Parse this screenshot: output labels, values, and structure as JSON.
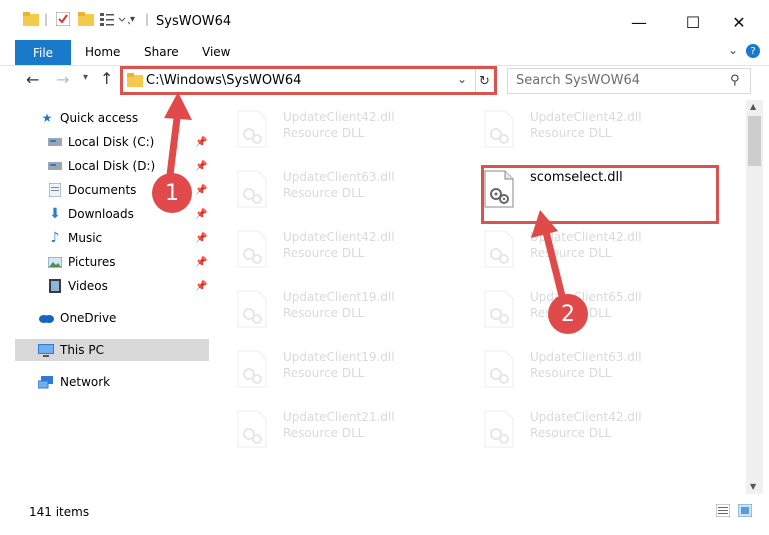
{
  "window": {
    "title": "SysWOW64",
    "minimize": "—",
    "maximize": "☐",
    "close": "✕"
  },
  "ribbon": {
    "tabs": [
      "File",
      "Home",
      "Share",
      "View"
    ],
    "expand": "⌄",
    "help": "?"
  },
  "address": {
    "path": "C:\\Windows\\SysWOW64",
    "dropdown": "⌄",
    "refresh": "↻"
  },
  "search": {
    "placeholder": "Search SysWOW64"
  },
  "nav": {
    "quick_access": "Quick access",
    "items": [
      {
        "label": "Local Disk (C:)",
        "icon": "drive-icon",
        "pinned": true
      },
      {
        "label": "Local Disk (D:)",
        "icon": "drive-icon",
        "pinned": true
      },
      {
        "label": "Documents",
        "icon": "documents-icon",
        "pinned": true
      },
      {
        "label": "Downloads",
        "icon": "downloads-icon",
        "pinned": true
      },
      {
        "label": "Music",
        "icon": "music-icon",
        "pinned": true
      },
      {
        "label": "Pictures",
        "icon": "pictures-icon",
        "pinned": true
      },
      {
        "label": "Videos",
        "icon": "videos-icon",
        "pinned": true
      }
    ],
    "onedrive": "OneDrive",
    "this_pc": "This PC",
    "network": "Network"
  },
  "files": {
    "left": [
      {
        "name": "UpdateClient42.dll",
        "type": "Resource DLL"
      },
      {
        "name": "UpdateClient63.dll",
        "type": "Resource DLL"
      },
      {
        "name": "UpdateClient42.dll",
        "type": "Resource DLL"
      },
      {
        "name": "UpdateClient19.dll",
        "type": "Resource DLL"
      },
      {
        "name": "UpdateClient19.dll",
        "type": "Resource DLL"
      },
      {
        "name": "UpdateClient21.dll",
        "type": "Resource DLL"
      }
    ],
    "right": [
      {
        "name": "UpdateClient42.dll",
        "type": "Resource DLL"
      },
      {
        "name": "scomselect.dll",
        "type": ""
      },
      {
        "name": "UpdateClient42.dll",
        "type": "Resource DLL"
      },
      {
        "name": "UpdateClient65.dll",
        "type": "Resource DLL"
      },
      {
        "name": "UpdateClient63.dll",
        "type": "Resource DLL"
      },
      {
        "name": "UpdateClient42.dll",
        "type": "Resource DLL"
      }
    ]
  },
  "status": {
    "count": "141 items"
  },
  "annotations": {
    "step1": "1",
    "step2": "2"
  },
  "colors": {
    "accent": "#1979ca",
    "annotation": "#e04a4a",
    "selection": "#d9d9d9"
  }
}
